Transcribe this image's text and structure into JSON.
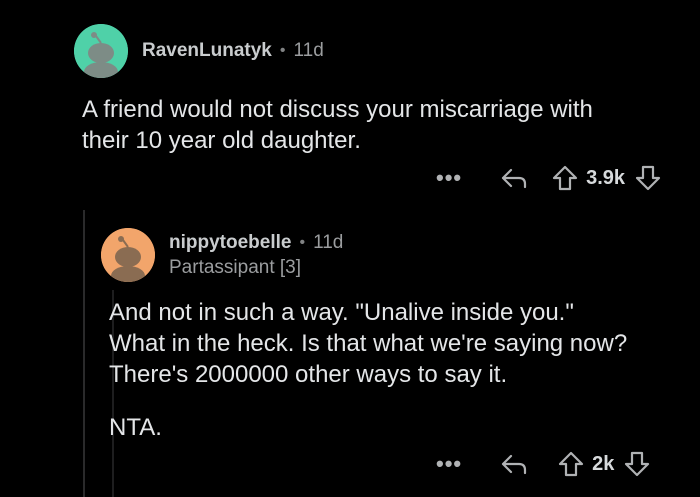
{
  "comments": [
    {
      "username": "RavenLunatyk",
      "separator": "•",
      "age": "11d",
      "body_lines": [
        "A friend would not discuss your miscarriage with",
        "their 10 year old daughter."
      ],
      "actions": {
        "more": "•••",
        "score": "3.9k"
      },
      "avatar_color": "#4fd1a8"
    },
    {
      "username": "nippytoebelle",
      "separator": "•",
      "age": "11d",
      "flair": "Partassipant [3]",
      "body_lines": [
        "And not in such a way. \"Unalive inside you.\"",
        "What in the heck. Is that what we're saying now?",
        "There's 2000000 other ways to say it."
      ],
      "body_extra": "NTA.",
      "actions": {
        "more": "•••",
        "score": "2k"
      },
      "avatar_color": "#f2a56b"
    }
  ],
  "icons": {
    "reply": "reply-arrow-icon",
    "upvote": "upvote-arrow-icon",
    "downvote": "downvote-arrow-icon"
  }
}
